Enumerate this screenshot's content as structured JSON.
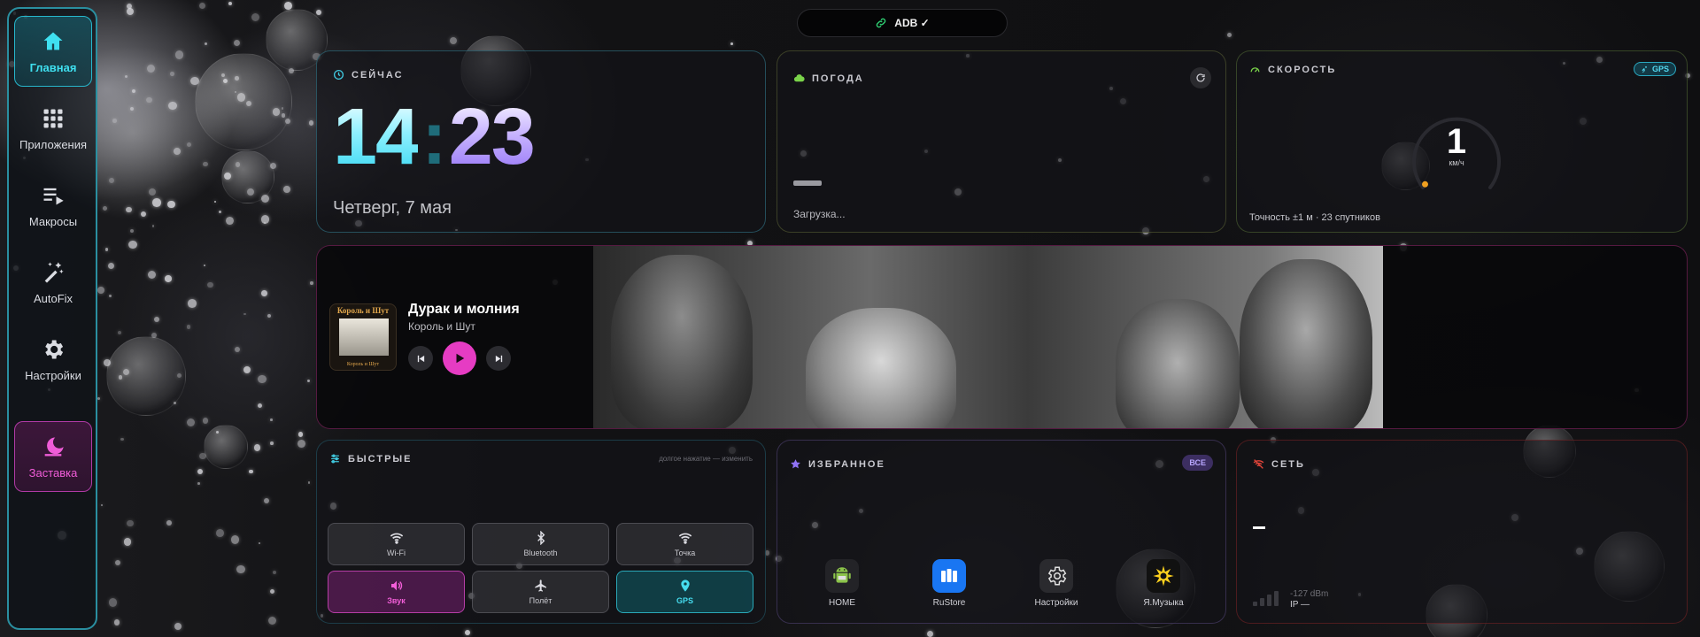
{
  "sidebar": {
    "items": [
      {
        "label": "Главная",
        "icon": "home-icon"
      },
      {
        "label": "Приложения",
        "icon": "apps-grid-icon"
      },
      {
        "label": "Макросы",
        "icon": "macros-icon"
      },
      {
        "label": "AutoFix",
        "icon": "magic-wand-icon"
      },
      {
        "label": "Настройки",
        "icon": "gear-icon"
      },
      {
        "label": "Заставка",
        "icon": "moon-icon"
      }
    ],
    "active_color": "#3fe0f0",
    "screensaver_color": "#f05cd8"
  },
  "adb": {
    "label": "ADB ✓",
    "icon": "link-icon",
    "icon_color": "#2ecc71"
  },
  "clock": {
    "title": "СЕЙЧАС",
    "hours": "14",
    "separator": ":",
    "minutes": "23",
    "date": "Четверг, 7 мая"
  },
  "weather": {
    "title": "ПОГОДА",
    "icon": "cloud-icon",
    "status": "Загрузка..."
  },
  "speed": {
    "title": "СКОРОСТЬ",
    "badge": "GPS",
    "value": "1",
    "unit": "км/ч",
    "accuracy": "Точность ±1 м · 23 спутников",
    "gauge_fraction": 0.01
  },
  "music": {
    "album_art_title": "Король и Шут",
    "album_art_subtitle": "Король и Шут",
    "track": "Дурак и молния",
    "artist": "Король и Шут",
    "play_color": "#e63cc3"
  },
  "quick": {
    "title": "БЫСТРЫЕ",
    "hint": "долгое нажатие — изменить",
    "tiles": [
      {
        "label": "Wi-Fi",
        "icon": "wifi-icon",
        "active": false
      },
      {
        "label": "Bluetooth",
        "icon": "bluetooth-icon",
        "active": false
      },
      {
        "label": "Точка",
        "icon": "hotspot-icon",
        "active": false
      },
      {
        "label": "Звук",
        "icon": "speaker-icon",
        "active": true
      },
      {
        "label": "Полёт",
        "icon": "airplane-icon",
        "active": false
      },
      {
        "label": "GPS",
        "icon": "location-pin-icon",
        "active": true
      }
    ]
  },
  "favorites": {
    "title": "ИЗБРАННОЕ",
    "all_label": "ВСЕ",
    "apps": [
      {
        "label": "HOME",
        "icon": "android-icon"
      },
      {
        "label": "RuStore",
        "icon": "rustore-icon"
      },
      {
        "label": "Настройки",
        "icon": "settings-gear-icon"
      },
      {
        "label": "Я.Музыка",
        "icon": "yandex-music-icon"
      }
    ]
  },
  "network": {
    "title": "СЕТЬ",
    "icon": "wifi-off-icon",
    "value": "–",
    "dbm": "-127 dBm",
    "ip": "IP —"
  }
}
